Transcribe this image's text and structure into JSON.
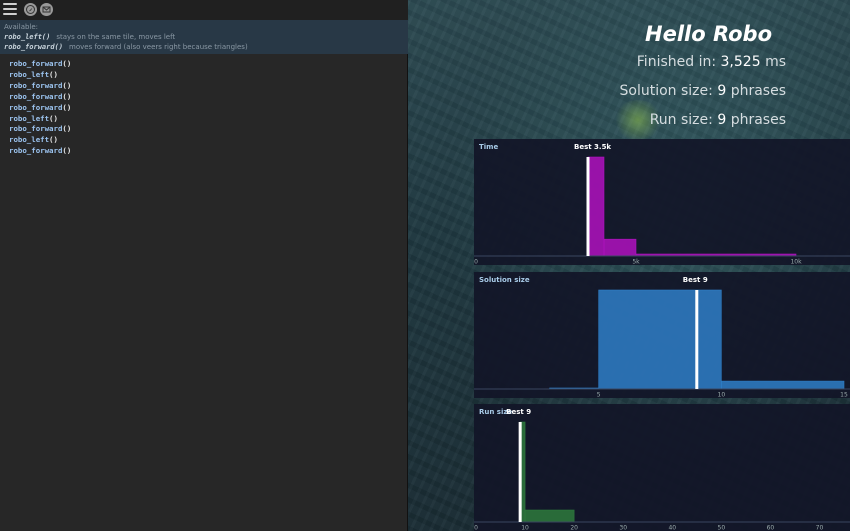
{
  "toolbar": {
    "menu_icon": "hamburger-menu-icon",
    "compass_icon": "compass-icon",
    "mail_icon": "mail-icon"
  },
  "info": {
    "available_label": "Available:",
    "functions": [
      {
        "name": "robo_left()",
        "description": "stays on the same tile, moves left"
      },
      {
        "name": "robo_forward()",
        "description": "moves forward (also veers right because triangles)"
      }
    ]
  },
  "code": {
    "lines": [
      {
        "fn": "robo_forward",
        "par": "()"
      },
      {
        "fn": "robo_left",
        "par": "()"
      },
      {
        "fn": "robo_forward",
        "par": "()"
      },
      {
        "fn": "robo_forward",
        "par": "()"
      },
      {
        "fn": "robo_forward",
        "par": "()"
      },
      {
        "fn": "robo_left",
        "par": "()"
      },
      {
        "fn": "robo_forward",
        "par": "()"
      },
      {
        "fn": "robo_left",
        "par": "()"
      },
      {
        "fn": "robo_forward",
        "par": "()"
      }
    ]
  },
  "results": {
    "title": "Hello Robo",
    "finished_label": "Finished in:",
    "finished_value": "3,525",
    "finished_unit": "ms",
    "solution_label": "Solution size:",
    "solution_value": "9",
    "solution_unit": "phrases",
    "run_label": "Run size:",
    "run_value": "9",
    "run_unit": "phrases"
  },
  "colors": {
    "time": "#b012c0",
    "solution": "#2f7fc8",
    "run": "#2e7a3c",
    "marker": "#ffffff"
  },
  "chart_data": [
    {
      "type": "area",
      "title": "Time",
      "best_label": "Best 3.5k",
      "best_x": 3500,
      "xlim": [
        0,
        11500
      ],
      "ticks": [
        {
          "v": 0,
          "t": "0"
        },
        {
          "v": 5000,
          "t": "5k"
        },
        {
          "v": 10000,
          "t": "10k"
        }
      ],
      "x": [
        3500,
        4000,
        5000,
        10000
      ],
      "values": [
        1.0,
        0.17,
        0.02,
        0
      ]
    },
    {
      "type": "area",
      "title": "Solution size",
      "best_label": "Best 9",
      "best_x": 9,
      "xlim": [
        0,
        15
      ],
      "ticks": [
        {
          "v": 5,
          "t": "5"
        },
        {
          "v": 10,
          "t": "10"
        },
        {
          "v": 15,
          "t": "15"
        }
      ],
      "x": [
        3,
        5,
        10,
        15
      ],
      "values": [
        0.01,
        1.0,
        0.08,
        0.08
      ]
    },
    {
      "type": "area",
      "title": "Run size",
      "best_label": "Best 9",
      "best_x": 9,
      "xlim": [
        0,
        75
      ],
      "ticks": [
        {
          "v": 0,
          "t": "0"
        },
        {
          "v": 10,
          "t": "10"
        },
        {
          "v": 20,
          "t": "20"
        },
        {
          "v": 30,
          "t": "30"
        },
        {
          "v": 40,
          "t": "40"
        },
        {
          "v": 50,
          "t": "50"
        },
        {
          "v": 60,
          "t": "60"
        },
        {
          "v": 70,
          "t": "70"
        }
      ],
      "x": [
        9,
        10,
        20
      ],
      "values": [
        1.0,
        0.12,
        0
      ]
    }
  ]
}
